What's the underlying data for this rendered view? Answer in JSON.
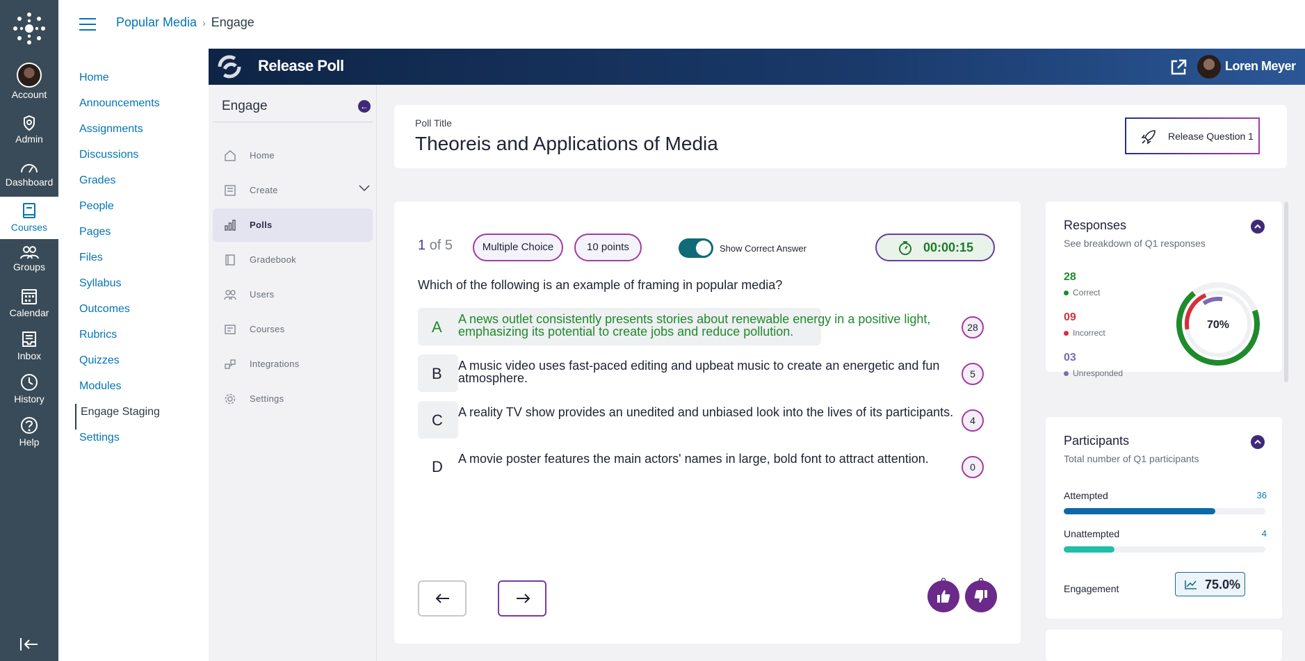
{
  "global_nav": {
    "items": [
      {
        "label": "Account",
        "icon": "user-avatar"
      },
      {
        "label": "Admin",
        "icon": "shield-icon"
      },
      {
        "label": "Dashboard",
        "icon": "speedometer-icon"
      },
      {
        "label": "Courses",
        "icon": "book-icon"
      },
      {
        "label": "Groups",
        "icon": "groups-icon"
      },
      {
        "label": "Calendar",
        "icon": "calendar-icon"
      },
      {
        "label": "Inbox",
        "icon": "inbox-icon"
      },
      {
        "label": "History",
        "icon": "clock-icon"
      },
      {
        "label": "Help",
        "icon": "help-icon"
      }
    ],
    "active_color": "#0374b5"
  },
  "breadcrumb": {
    "course": "Popular Media",
    "current": "Engage"
  },
  "course_nav": {
    "items": [
      "Home",
      "Announcements",
      "Assignments",
      "Discussions",
      "Grades",
      "People",
      "Pages",
      "Files",
      "Syllabus",
      "Outcomes",
      "Rubrics",
      "Quizzes",
      "Modules",
      "Engage Staging",
      "Settings"
    ],
    "active": "Engage Staging"
  },
  "app": {
    "title": "Release Poll",
    "user_name": "Loren Meyer"
  },
  "engage_menu": {
    "title": "Engage",
    "items": [
      {
        "label": "Home",
        "icon": "home-icon"
      },
      {
        "label": "Create",
        "icon": "create-icon"
      },
      {
        "label": "Polls",
        "icon": "bar-chart-icon"
      },
      {
        "label": "Gradebook",
        "icon": "gradebook-icon"
      },
      {
        "label": "Users",
        "icon": "users-icon"
      },
      {
        "label": "Courses",
        "icon": "courses-icon"
      },
      {
        "label": "Integrations",
        "icon": "integrations-icon"
      },
      {
        "label": "Settings",
        "icon": "gear-icon"
      }
    ],
    "active": "Polls"
  },
  "poll": {
    "title_label": "Poll Title",
    "title": "Theoreis and Applications of Media",
    "release_button": "Release Question 1"
  },
  "question": {
    "current": "1",
    "of_total": "of 5",
    "type": "Multiple Choice",
    "points": "10 points",
    "show_correct_label": "Show Correct Answer",
    "show_correct_on": true,
    "timer": "00:00:15",
    "text": "Which of the following is an example of framing in popular media?",
    "options": [
      {
        "letter": "A",
        "text": "A news outlet consistently presents stories about renewable energy in a positive light, emphasizing its potential to create jobs and reduce pollution.",
        "count": "28",
        "correct": true
      },
      {
        "letter": "B",
        "text": "A music video uses fast-paced editing and upbeat music to create an energetic and fun atmosphere.",
        "count": "5",
        "correct": false
      },
      {
        "letter": "C",
        "text": "A reality TV show provides an unedited and unbiased look into the lives of its participants.",
        "count": "4",
        "correct": false
      },
      {
        "letter": "D",
        "text": "A movie poster features the main actors' names in large, bold font to attract attention.",
        "count": "0",
        "correct": false
      }
    ],
    "thumbs_up_count": "0",
    "thumbs_down_count": "0"
  },
  "responses": {
    "title": "Responses",
    "subtitle": "See breakdown of Q1 responses",
    "correct": {
      "value": "28",
      "label": "Correct",
      "color": "#1f8a2b"
    },
    "incorrect": {
      "value": "09",
      "label": "Incorrect",
      "color": "#d62f3a"
    },
    "unresponded": {
      "value": "03",
      "label": "Unresponded",
      "color": "#7a6ab8"
    },
    "percent": "70%"
  },
  "participants": {
    "title": "Participants",
    "subtitle": "Total number of Q1 participants",
    "attempted": {
      "label": "Attempted",
      "value": "36",
      "fraction": 0.75,
      "color": "#0d6aa8"
    },
    "unattempted": {
      "label": "Unattempted",
      "value": "4",
      "fraction": 0.25,
      "color": "#1fbfa8"
    },
    "engagement_label": "Engagement",
    "engagement_value": "75.0%"
  }
}
